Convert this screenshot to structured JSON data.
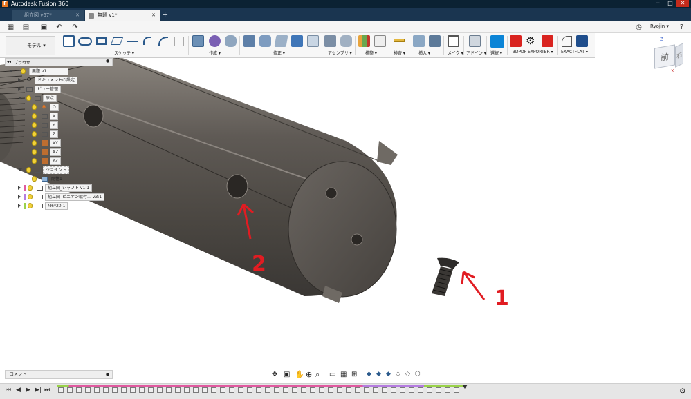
{
  "app": {
    "title": "Autodesk Fusion 360",
    "logo_letter": "F"
  },
  "window_controls": {
    "min": "─",
    "max": "□",
    "close": "✕"
  },
  "tabs": [
    {
      "label": "組立図 v67*",
      "active": false
    },
    {
      "label": "無題 v1*",
      "active": true
    }
  ],
  "tab_close": "✕",
  "tab_add": "+",
  "user": {
    "name": "Ryojin ▾"
  },
  "workspace": {
    "label": "モデル ▾"
  },
  "ribbon_groups": [
    {
      "label": "スケッチ ▾"
    },
    {
      "label": "作成 ▾"
    },
    {
      "label": "修正 ▾"
    },
    {
      "label": "アセンブリ ▾"
    },
    {
      "label": "構築 ▾"
    },
    {
      "label": "検査 ▾"
    },
    {
      "label": "挿入 ▾"
    },
    {
      "label": "メイク ▾"
    },
    {
      "label": "アドイン ▾"
    },
    {
      "label": "選択 ▾"
    },
    {
      "label": "3DPDF EXPORTER ▾"
    },
    {
      "label": "EXACTFLAT ▾"
    }
  ],
  "browser": {
    "title": "ブラウザ",
    "root": "無題 v1",
    "items": {
      "doc_settings": "ドキュメントの設定",
      "named_views": "ビュー管理",
      "origin": "原点",
      "o": "O",
      "x": "X",
      "y": "Y",
      "z": "Z",
      "xy": "XY",
      "xz": "XZ",
      "yz": "YZ",
      "joints": "ジョイント",
      "rigid": "剛性1",
      "comp1": "組立図_シャフト v1:1",
      "comp2": "組立図_ピニオン取付… v3:1",
      "comp3": "M6*20:1"
    }
  },
  "comment": {
    "label": "コメント"
  },
  "viewcube": {
    "front": "前",
    "left": "右",
    "z": "Z",
    "x": "X"
  },
  "annotations": {
    "one": "1",
    "two": "2"
  },
  "colors": {
    "accent": "#e11c22",
    "title_bg": "#0b2233",
    "tab_bg": "#1a3550",
    "select_blue": "#0b84d6"
  }
}
